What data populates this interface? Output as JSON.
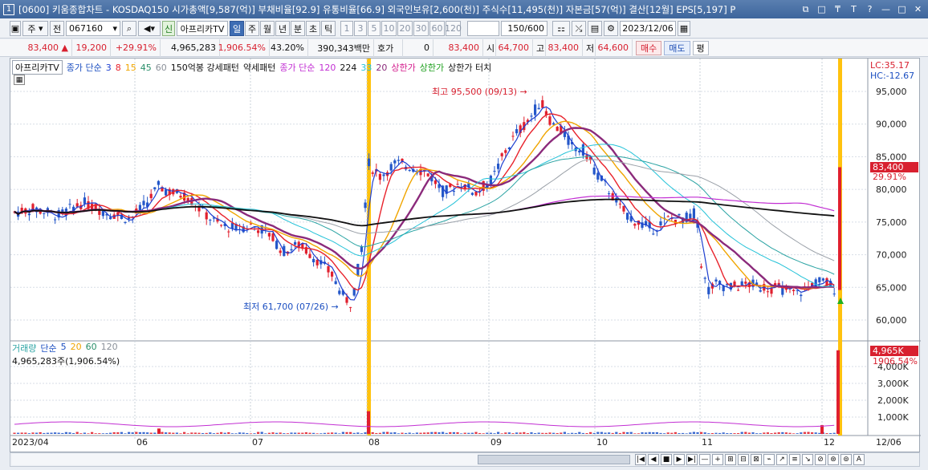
{
  "title": {
    "window_number": "1",
    "text": "[0600] 키움종합차트 - KOSDAQ150 시가총액[9,587(억)] 부채비율[92.9] 유통비율[66.9] 외국인보유[2,600(천)] 주식수[11,495(천)] 자본금[57(억)] 결산[12월] EPS[5,197] P",
    "buttons": [
      "⧉",
      "□",
      "₸",
      "T",
      "?",
      "—",
      "□",
      "✕"
    ]
  },
  "toolbar": {
    "type_label": "주",
    "prev_label": "전",
    "code_value": "067160",
    "news_label": "신",
    "stock_name": "아프리카TV",
    "periods": [
      "일",
      "주",
      "월",
      "년",
      "분",
      "초",
      "틱"
    ],
    "selected_period": "일",
    "minutes": [
      "1",
      "3",
      "5",
      "10",
      "20",
      "30",
      "60",
      "120"
    ],
    "count": "150/600",
    "date": "2023/12/06"
  },
  "quote": {
    "price": "83,400",
    "change": "19,200",
    "change_pct": "+29.91%",
    "volume": "4,965,283",
    "volume_ratio": "1,906.54%",
    "turnover": "43.20%",
    "amount": "390,343백만",
    "hoga_label": "호가",
    "hoga_value": "0",
    "hoga_price": "83,400",
    "open_label": "시",
    "open": "64,700",
    "high_label": "고",
    "high": "83,400",
    "low_label": "저",
    "low": "64,600",
    "buy_label": "매수",
    "sell_label": "매도",
    "avg_label": "평"
  },
  "legend": {
    "name": "아프리카TV",
    "close_label": "종가 단순",
    "ma_short": [
      "3",
      "8",
      "15",
      "45",
      "60"
    ],
    "pattern1": "150억봉 강세패턴",
    "pattern2": "약세패턴",
    "close_label2": "종가 단순",
    "ma_long": [
      "120",
      "224",
      "33",
      "20"
    ],
    "limit_up": "상한가",
    "limit_up2": "상한가",
    "limit_up_touch": "상한가 터치"
  },
  "colors": {
    "up": "#e0202e",
    "down": "#2457c9",
    "ma3": "#1d3fd0",
    "ma8": "#e8222b",
    "ma15": "#f0a500",
    "ma45": "#2aa3a3",
    "ma60": "#9aa0a8",
    "ma120": "#c22fd3",
    "ma224": "#111111",
    "ma33": "#23c2d8",
    "ma20": "#8b2a7b",
    "highlight": "#ffc20e"
  },
  "annotations": {
    "high": "최고 95,500 (09/13)",
    "low": "최저 61,700 (07/26)"
  },
  "right_axis": {
    "lc": "LC:35.17",
    "hc": "HC:-12.67",
    "price_labels": [
      "95,000",
      "90,000",
      "85,000",
      "80,000",
      "75,000",
      "70,000",
      "65,000",
      "60,000"
    ],
    "current_price": "83,400",
    "current_pct": "29.91%",
    "volume_labels": [
      "4,000K",
      "3,000K",
      "2,000K",
      "1,000K"
    ],
    "current_volume": "4,965K",
    "current_vol_pct": "1906.54%"
  },
  "volume_legend": {
    "label": "거래량",
    "ma_label": "단순",
    "mas": [
      "5",
      "20",
      "60",
      "120"
    ],
    "value": "4,965,283주(1,906.54%)"
  },
  "x_axis": [
    "2023/04",
    "06",
    "07",
    "08",
    "09",
    "10",
    "11",
    "12",
    "12/06"
  ],
  "scroll": [
    "|◀",
    "◀",
    "■",
    "▶",
    "▶|",
    "—",
    "+",
    "⊞",
    "⊟",
    "⊠",
    "⌁",
    "↗",
    "≡",
    "↘",
    "⊘",
    "⊛",
    "⊚",
    "A"
  ]
}
